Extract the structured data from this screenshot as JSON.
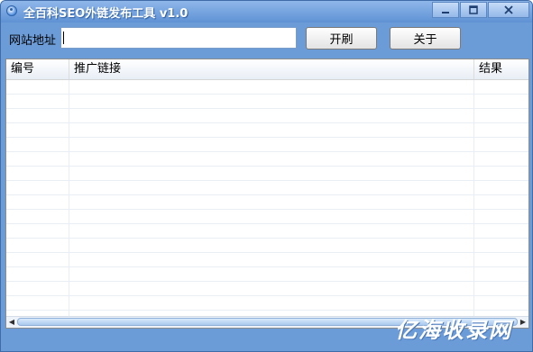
{
  "window": {
    "title": "全百科SEO外链发布工具 v1.0",
    "icon": "app-globe-icon",
    "controls": [
      "minimize-icon",
      "maximize-icon",
      "close-icon"
    ]
  },
  "toolbar": {
    "address_label": "网站地址",
    "address_value": "",
    "open_button": "开刷",
    "close_button": "关于"
  },
  "list": {
    "columns": [
      "编号",
      "推广链接",
      "结果"
    ],
    "rows": []
  },
  "watermark": "亿海收录网",
  "colors": {
    "window_frame": "#6c9cd8",
    "title_text": "#ffffff",
    "list_background": "#ffffff",
    "row_line": "#e9eef4"
  }
}
